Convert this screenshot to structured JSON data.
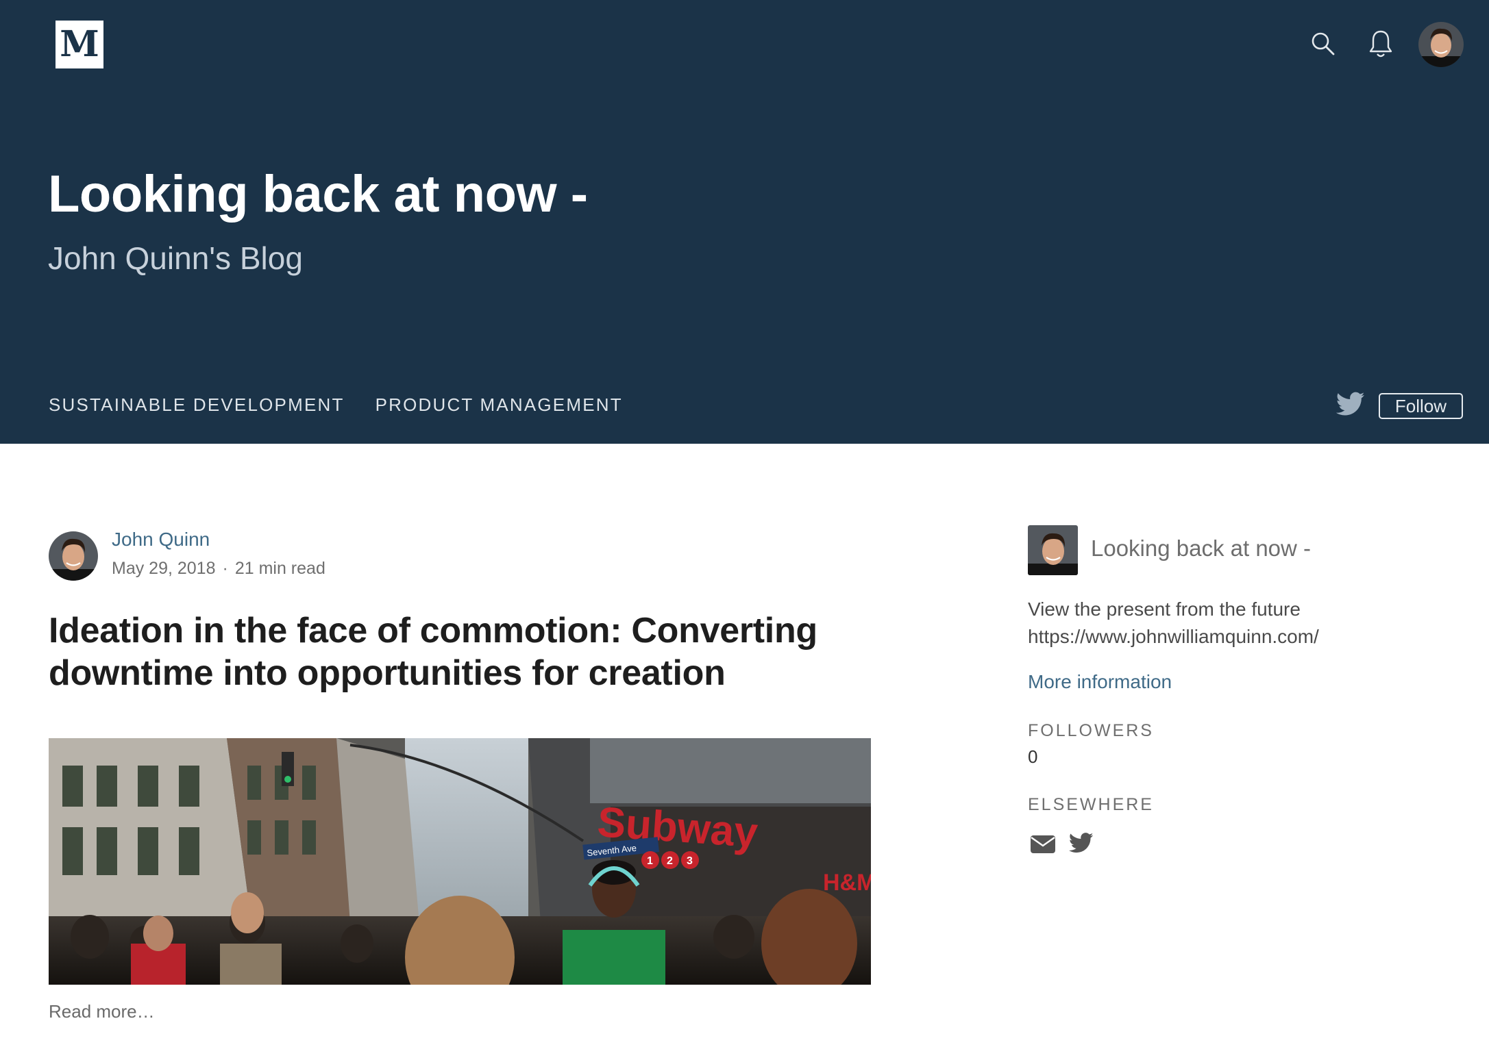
{
  "header": {
    "logo_letter": "M",
    "title": "Looking back at now -",
    "subtitle": "John Quinn's Blog",
    "nav": [
      "SUSTAINABLE DEVELOPMENT",
      "PRODUCT MANAGEMENT"
    ],
    "follow_label": "Follow",
    "icons": [
      "search-icon",
      "bell-icon",
      "avatar",
      "twitter-icon"
    ]
  },
  "post": {
    "author": "John Quinn",
    "date": "May 29, 2018",
    "separator": "·",
    "read_time": "21 min read",
    "title": "Ideation in the face of commotion: Converting downtime into opportunities for creation",
    "image_texts": {
      "sign": "Subway",
      "street": "Seventh Ave",
      "lines": [
        "1",
        "2",
        "3"
      ],
      "store": "H&M"
    },
    "read_more": "Read more…"
  },
  "sidebar": {
    "pub_name": "Looking back at now -",
    "description_line1": "View the present from the future",
    "description_line2": "https://www.johnwilliamquinn.com/",
    "more_info": "More information",
    "followers_label": "FOLLOWERS",
    "followers_count": "0",
    "elsewhere_label": "ELSEWHERE",
    "icons": [
      "mail-icon",
      "twitter-icon"
    ]
  },
  "colors": {
    "header_bg": "#1b3348",
    "link": "#3f6a87",
    "title_text": "#1e1e1e"
  }
}
